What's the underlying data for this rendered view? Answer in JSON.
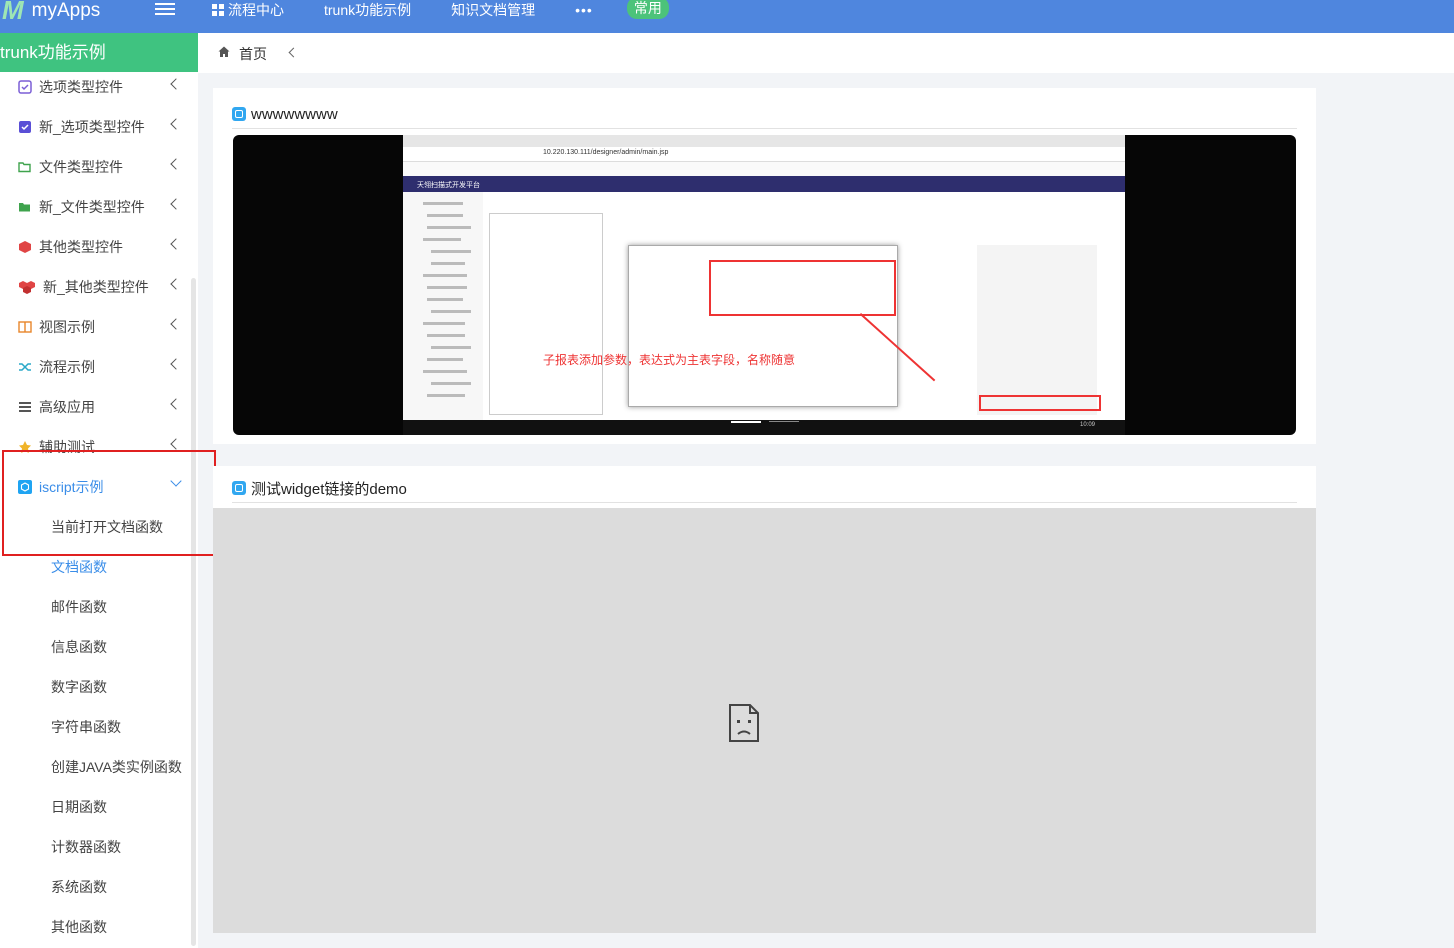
{
  "topbar": {
    "logo_mark": "M",
    "logo_text": "myApps",
    "nav": [
      "流程中心",
      "trunk功能示例",
      "知识文档管理"
    ],
    "more": "•••",
    "badge": "常用"
  },
  "sidebar": {
    "title": "trunk功能示例",
    "items": [
      {
        "label": "选项类型控件",
        "icon": "checkbox-icon"
      },
      {
        "label": "新_选项类型控件",
        "icon": "checkbox-filled-icon"
      },
      {
        "label": "文件类型控件",
        "icon": "folder-open-icon"
      },
      {
        "label": "新_文件类型控件",
        "icon": "folder-icon"
      },
      {
        "label": "其他类型控件",
        "icon": "cube-icon"
      },
      {
        "label": "新_其他类型控件",
        "icon": "cubes-icon"
      },
      {
        "label": "视图示例",
        "icon": "columns-icon"
      },
      {
        "label": "流程示例",
        "icon": "shuffle-icon"
      },
      {
        "label": "高级应用",
        "icon": "list-icon"
      },
      {
        "label": "辅助测试",
        "icon": "star-icon"
      },
      {
        "label": "iscript示例",
        "icon": "cube-app-icon"
      }
    ],
    "sub_items": [
      "当前打开文档函数",
      "文档函数",
      "邮件函数",
      "信息函数",
      "数字函数",
      "字符串函数",
      "创建JAVA类实例函数",
      "日期函数",
      "计数器函数",
      "系统函数",
      "其他函数"
    ]
  },
  "breadcrumb": {
    "home": "首页"
  },
  "cards": [
    {
      "title": "wwwwwwww"
    },
    {
      "title": "测试widget链接的demo"
    }
  ],
  "video": {
    "url": "10.220.130.111/designer/admin/main.jsp",
    "app_title": "天翎扫描式开发平台",
    "annotation": "子报表添加参数，表达式为主表字段，名称随意",
    "time": "10:09"
  },
  "colors": {
    "topbar": "#4f86de",
    "sidebar_title": "#3fc380",
    "active": "#3a8de8",
    "highlight": "#e02020"
  }
}
